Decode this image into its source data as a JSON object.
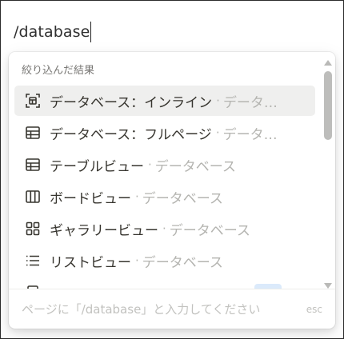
{
  "editor": {
    "command_text": "/database"
  },
  "menu": {
    "section_header": "絞り込んだ結果",
    "items": [
      {
        "icon": "inline-database-icon",
        "label": "データベース：インライン",
        "separator": "·",
        "description": "データ…",
        "selected": true
      },
      {
        "icon": "table-icon",
        "label": "データベース：フルページ",
        "separator": "·",
        "description": "データ…",
        "selected": false
      },
      {
        "icon": "table-icon",
        "label": "テーブルビュー",
        "separator": "·",
        "description": "データベース",
        "selected": false
      },
      {
        "icon": "board-icon",
        "label": "ボードビュー",
        "separator": "·",
        "description": "データベース",
        "selected": false
      },
      {
        "icon": "gallery-icon",
        "label": "ギャラリービュー",
        "separator": "·",
        "description": "データベース",
        "selected": false
      },
      {
        "icon": "list-icon",
        "label": "リストビュー",
        "separator": "·",
        "description": "データベース",
        "selected": false
      }
    ],
    "footer_hint": "ページに「/database」と入力してください",
    "footer_shortcut": "esc"
  }
}
